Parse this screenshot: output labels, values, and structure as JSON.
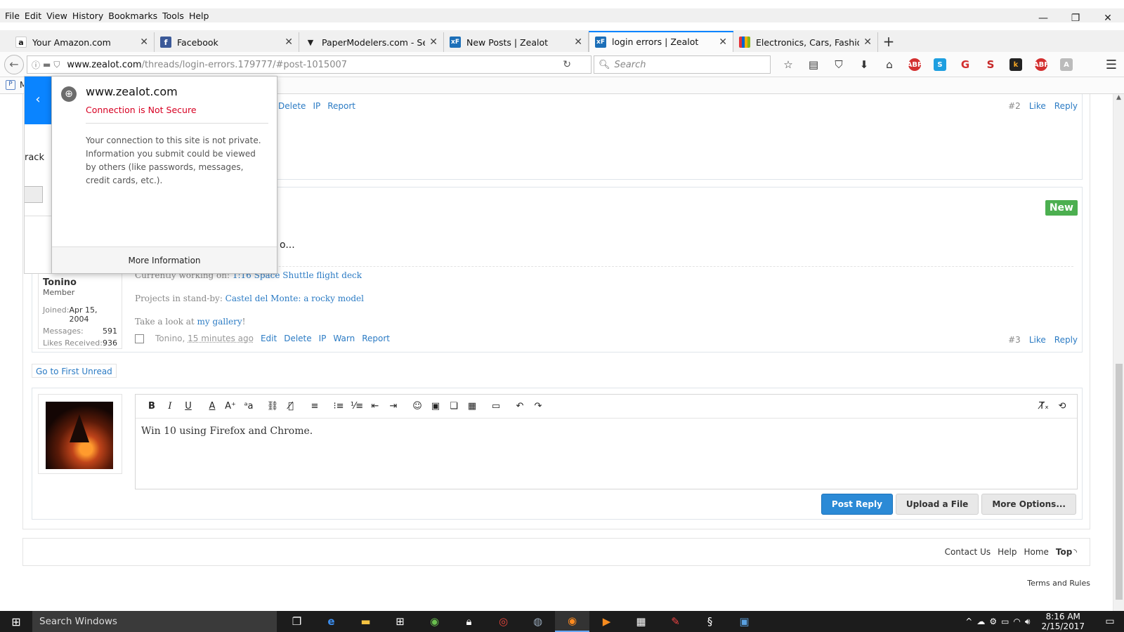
{
  "menu": [
    "File",
    "Edit",
    "View",
    "History",
    "Bookmarks",
    "Tools",
    "Help"
  ],
  "window_controls": [
    "—",
    "❐",
    "✕"
  ],
  "tabs": [
    {
      "title": "Your Amazon.com",
      "favicon": "a",
      "favicon_color": "#111111"
    },
    {
      "title": "Facebook",
      "favicon": "f",
      "favicon_color": "#3b5998"
    },
    {
      "title": "PaperModelers.com - Sear...",
      "favicon": "▼",
      "favicon_color": "#222222"
    },
    {
      "title": "New Posts | Zealot",
      "favicon": "xF",
      "favicon_color": "#1c6fb8"
    },
    {
      "title": "login errors | Zealot",
      "favicon": "xF",
      "favicon_color": "#1c6fb8",
      "active": true
    },
    {
      "title": "Electronics, Cars, Fashion, ...",
      "favicon": "e",
      "favicon_color": "#e53238"
    }
  ],
  "nav": {
    "url_host": "www.zealot.com",
    "url_path": "/threads/login-errors.179777/#post-1015007",
    "search_placeholder": "Search"
  },
  "bookmarks": {
    "first_label": "M"
  },
  "identity_popup": {
    "host": "www.zealot.com",
    "status": "Connection is Not Secure",
    "description": "Your connection to this site is not private. Information you submit could be viewed by others (like passwords, messages, credit cards, etc.).",
    "more_info": "More Information",
    "left_fragment": "rack"
  },
  "post2": {
    "links": [
      "Delete",
      "IP",
      "Report"
    ],
    "number": "#2",
    "right_links": [
      "Like",
      "Reply"
    ]
  },
  "post3": {
    "badge": "New",
    "snippet": "o...",
    "sig_working_prefix": "Currently working on: ",
    "sig_working_link": "1:16 Space Shuttle flight deck",
    "sig_standby_prefix": "Projects in stand-by: ",
    "sig_standby_link": "Castel del Monte: a rocky model",
    "sig_gallery_prefix": "Take a look at ",
    "sig_gallery_link": "my gallery",
    "sig_gallery_suffix": "!",
    "user": {
      "name": "Tonino",
      "title": "Member",
      "joined_label": "Joined:",
      "joined": "Apr 15, 2004",
      "messages_label": "Messages:",
      "messages": "591",
      "likes_label": "Likes Received:",
      "likes": "936"
    },
    "author_line": "Tonino, ",
    "time": "15 minutes ago",
    "footer_links": [
      "Edit",
      "Delete",
      "IP",
      "Warn",
      "Report"
    ],
    "number": "#3",
    "right_links": [
      "Like",
      "Reply"
    ]
  },
  "first_unread": "Go to First Unread",
  "editor": {
    "content": "Win 10 using Firefox and Chrome.",
    "post_reply": "Post Reply",
    "upload": "Upload a File",
    "more_options": "More Options..."
  },
  "footer": {
    "links": [
      "Contact Us",
      "Help",
      "Home",
      "Top"
    ],
    "terms": "Terms and Rules"
  },
  "taskbar": {
    "search": "Search Windows",
    "time": "8:16 AM",
    "date": "2/15/2017"
  },
  "colors": {
    "accent": "#0a84ff",
    "link": "#2b7bc4",
    "insecure": "#d70022",
    "new_badge": "#4caf50"
  }
}
